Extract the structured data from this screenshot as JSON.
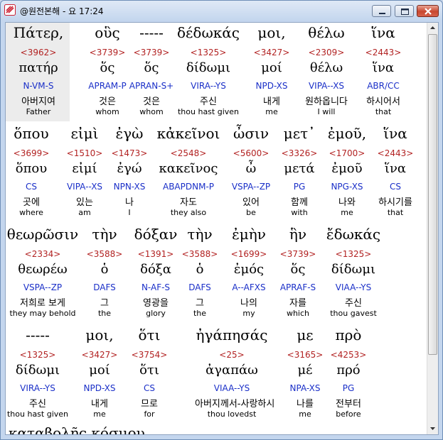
{
  "window": {
    "title": "@원전본해 - 요 17:24"
  },
  "rows": [
    [
      {
        "greek": "Πάτερ,",
        "strong": "<3962>",
        "lemma": "πατήρ",
        "parse": "N-VM-S",
        "korean": "아버지여",
        "english": "Father"
      },
      {
        "greek": "οὓς",
        "strong": "<3739>",
        "lemma": "ὅς",
        "parse": "APRAM-P",
        "korean": "것은",
        "english": "whom"
      },
      {
        "greek": "-----",
        "strong": "<3739>",
        "lemma": "ὅς",
        "parse": "APRAN-S+",
        "korean": "것은",
        "english": "whom"
      },
      {
        "greek": "δέδωκάς",
        "strong": "<1325>",
        "lemma": "δίδωμι",
        "parse": "VIRA--YS",
        "korean": "주신",
        "english": "thou hast given"
      },
      {
        "greek": "μοι,",
        "strong": "<3427>",
        "lemma": "μοί",
        "parse": "NPD-XS",
        "korean": "내게",
        "english": "me"
      },
      {
        "greek": "θέλω",
        "strong": "<2309>",
        "lemma": "θέλω",
        "parse": "VIPA--XS",
        "korean": "원하옵니다",
        "english": "I will"
      },
      {
        "greek": "ἵνα",
        "strong": "<2443>",
        "lemma": "ἵνα",
        "parse": "ABR/CC",
        "korean": "하시어서",
        "english": "that"
      }
    ],
    [
      {
        "greek": "ὅπου",
        "strong": "<3699>",
        "lemma": "ὅπου",
        "parse": "CS",
        "korean": "곳에",
        "english": "where"
      },
      {
        "greek": "εἰμὶ",
        "strong": "<1510>",
        "lemma": "εἰμί",
        "parse": "VIPA--XS",
        "korean": "있는",
        "english": "am"
      },
      {
        "greek": "ἐγὼ",
        "strong": "<1473>",
        "lemma": "ἐγώ",
        "parse": "NPN-XS",
        "korean": "나",
        "english": "I"
      },
      {
        "greek": "κἀκεῖνοι",
        "strong": "<2548>",
        "lemma": "κακεῖνος",
        "parse": "ABAPDNM-P",
        "korean": "자도",
        "english": "they also"
      },
      {
        "greek": "ὦσιν",
        "strong": "<5600>",
        "lemma": "ὦ",
        "parse": "VSPA--ZP",
        "korean": "있어",
        "english": "be"
      },
      {
        "greek": "μετ᾽",
        "strong": "<3326>",
        "lemma": "μετά",
        "parse": "PG",
        "korean": "함께",
        "english": "with"
      },
      {
        "greek": "ἐμοῦ,",
        "strong": "<1700>",
        "lemma": "ἐμοῦ",
        "parse": "NPG-XS",
        "korean": "나와",
        "english": "me"
      },
      {
        "greek": "ἵνα",
        "strong": "<2443>",
        "lemma": "ἵνα",
        "parse": "CS",
        "korean": "하시기를",
        "english": "that"
      }
    ],
    [
      {
        "greek": "θεωρῶσιν",
        "strong": "<2334>",
        "lemma": "θεωρέω",
        "parse": "VSPA--ZP",
        "korean": "저희로 보게",
        "english": "they may behold"
      },
      {
        "greek": "τὴν",
        "strong": "<3588>",
        "lemma": "ὁ",
        "parse": "DAFS",
        "korean": "그",
        "english": "the"
      },
      {
        "greek": "δόξαν",
        "strong": "<1391>",
        "lemma": "δόξα",
        "parse": "N-AF-S",
        "korean": "영광을",
        "english": "glory"
      },
      {
        "greek": "τὴν",
        "strong": "<3588>",
        "lemma": "ὁ",
        "parse": "DAFS",
        "korean": "그",
        "english": "the"
      },
      {
        "greek": "ἐμὴν",
        "strong": "<1699>",
        "lemma": "ἐμός",
        "parse": "A--AFXS",
        "korean": "나의",
        "english": "my"
      },
      {
        "greek": "ἣν",
        "strong": "<3739>",
        "lemma": "ὅς",
        "parse": "APRAF-S",
        "korean": "자를",
        "english": "which"
      },
      {
        "greek": "ἔδωκάς",
        "strong": "<1325>",
        "lemma": "δίδωμι",
        "parse": "VIAA--YS",
        "korean": "주신",
        "english": "thou gavest"
      }
    ],
    [
      {
        "greek": "-----",
        "strong": "<1325>",
        "lemma": "δίδωμι",
        "parse": "VIRA--YS",
        "korean": "주신",
        "english": "thou hast given"
      },
      {
        "greek": "μοι,",
        "strong": "<3427>",
        "lemma": "μοί",
        "parse": "NPD-XS",
        "korean": "내게",
        "english": "me"
      },
      {
        "greek": "ὅτι",
        "strong": "<3754>",
        "lemma": "ὅτι",
        "parse": "CS",
        "korean": "므로",
        "english": "for"
      },
      {
        "greek": "ἠγάπησάς",
        "strong": "<25>",
        "lemma": "ἀγαπάω",
        "parse": "VIAA--YS",
        "korean": "아버지께서-사랑하시",
        "english": "thou lovedst"
      },
      {
        "greek": "με",
        "strong": "<3165>",
        "lemma": "μέ",
        "parse": "NPA-XS",
        "korean": "나를",
        "english": "me"
      },
      {
        "greek": "πρὸ",
        "strong": "<4253>",
        "lemma": "πρό",
        "parse": "PG",
        "korean": "전부터",
        "english": "before"
      }
    ]
  ],
  "partial_line": "καταβολῆς κόσμου."
}
